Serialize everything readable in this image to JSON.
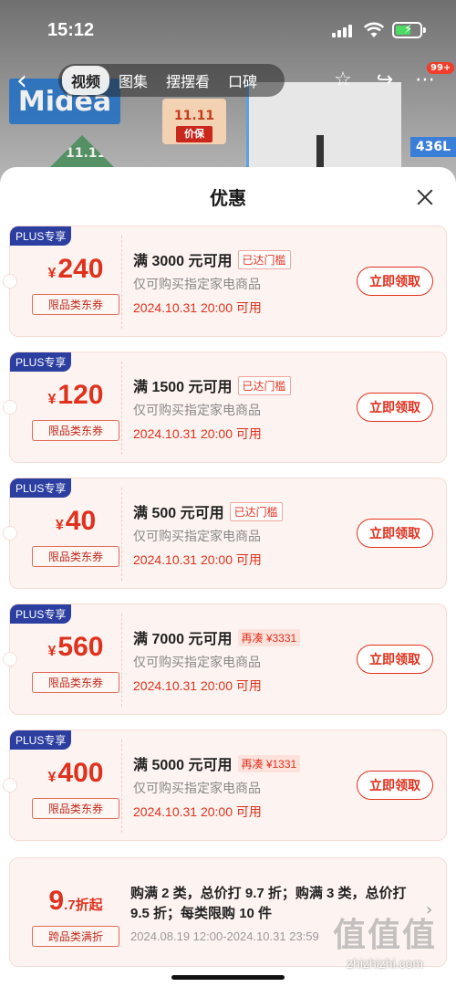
{
  "status_bar": {
    "time": "15:12"
  },
  "background": {
    "brand_logo": "Midea",
    "promo_tag": "11.11",
    "promo_tag_sub": "价保",
    "size_label": "436L",
    "event_label": "11.11"
  },
  "nav": {
    "tabs": [
      {
        "label": "视频",
        "active": true
      },
      {
        "label": "图集",
        "active": false
      },
      {
        "label": "摆摆看",
        "active": false
      },
      {
        "label": "口碑",
        "active": false
      }
    ],
    "message_badge": "99+"
  },
  "sheet": {
    "title": "优惠",
    "coupons": [
      {
        "badge": "PLUS专享",
        "currency": "¥",
        "amount": "240",
        "type": "限品类东券",
        "condition": "满 3000 元可用",
        "tag": "已达门槛",
        "tag_kind": "ok",
        "desc": "仅可购买指定家电商品",
        "date": "2024.10.31 20:00 可用",
        "button": "立即领取"
      },
      {
        "badge": "PLUS专享",
        "currency": "¥",
        "amount": "120",
        "type": "限品类东券",
        "condition": "满 1500 元可用",
        "tag": "已达门槛",
        "tag_kind": "ok",
        "desc": "仅可购买指定家电商品",
        "date": "2024.10.31 20:00 可用",
        "button": "立即领取"
      },
      {
        "badge": "PLUS专享",
        "currency": "¥",
        "amount": "40",
        "type": "限品类东券",
        "condition": "满 500 元可用",
        "tag": "已达门槛",
        "tag_kind": "ok",
        "desc": "仅可购买指定家电商品",
        "date": "2024.10.31 20:00 可用",
        "button": "立即领取"
      },
      {
        "badge": "PLUS专享",
        "currency": "¥",
        "amount": "560",
        "type": "限品类东券",
        "condition": "满 7000 元可用",
        "tag": "再凑 ¥3331",
        "tag_kind": "more",
        "desc": "仅可购买指定家电商品",
        "date": "2024.10.31 20:00 可用",
        "button": "立即领取"
      },
      {
        "badge": "PLUS专享",
        "currency": "¥",
        "amount": "400",
        "type": "限品类东券",
        "condition": "满 5000 元可用",
        "tag": "再凑 ¥1331",
        "tag_kind": "more",
        "desc": "仅可购买指定家电商品",
        "date": "2024.10.31 20:00 可用",
        "button": "立即领取"
      }
    ],
    "promo": {
      "big": "9",
      "small": ".7折起",
      "type": "跨品类满折",
      "text": "购满 2 类，总价打 9.7 折；购满 3 类，总价打 9.5 折；每类限购 10 件",
      "date": "2024.08.19 12:00-2024.10.31 23:59"
    }
  },
  "watermark": {
    "top": "值值值",
    "url": "zhizhizhi.com"
  }
}
